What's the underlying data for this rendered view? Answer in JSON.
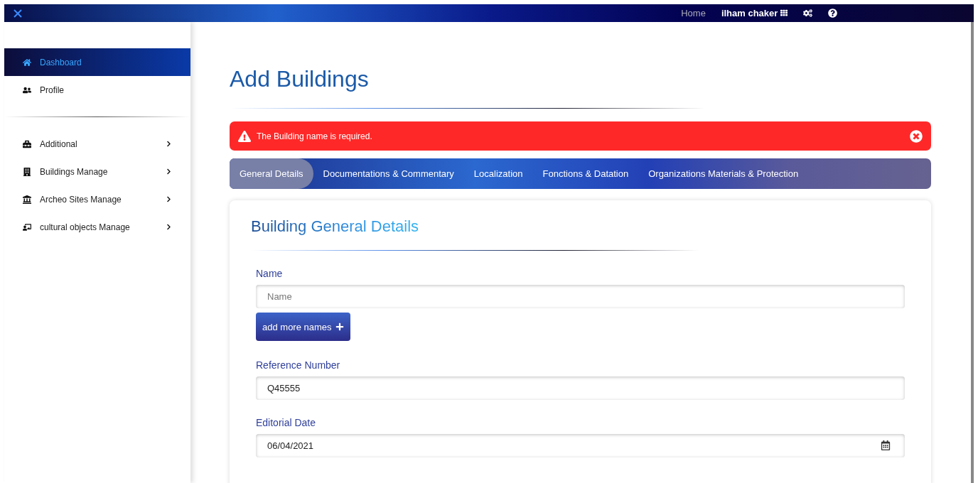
{
  "topbar": {
    "links": [
      {
        "label": "Home",
        "selected": false
      },
      {
        "label": "ilham chaker",
        "selected": true
      }
    ]
  },
  "sidebar": {
    "items": [
      {
        "label": "Dashboard",
        "selected": true
      },
      {
        "label": "Profile",
        "selected": false
      }
    ],
    "menus": [
      {
        "label": "Additional",
        "expandable": true
      },
      {
        "label": "Buildings Manage",
        "expandable": true
      },
      {
        "label": "Archeo Sites Manage",
        "expandable": true
      },
      {
        "label": "cultural objects Manage",
        "expandable": true
      }
    ]
  },
  "page": {
    "title": "Add Buildings"
  },
  "alert": {
    "message": "The Building name is required."
  },
  "tabs": [
    {
      "label": "General Details",
      "selected": true
    },
    {
      "label": "Documentations & Commentary",
      "selected": false
    },
    {
      "label": "Localization",
      "selected": false
    },
    {
      "label": "Fonctions & Datation",
      "selected": false
    },
    {
      "label": "Organizations Materials & Protection",
      "selected": false
    }
  ],
  "card": {
    "title": "Building General Details",
    "fields": [
      {
        "kind": "text",
        "label": "Name",
        "placeholder": "Name",
        "add_button": "add more names"
      },
      {
        "kind": "text",
        "label": "Reference Number",
        "value": "Q45555"
      },
      {
        "kind": "date",
        "label": "Editorial Date",
        "value": "06/04/2021"
      }
    ]
  }
}
